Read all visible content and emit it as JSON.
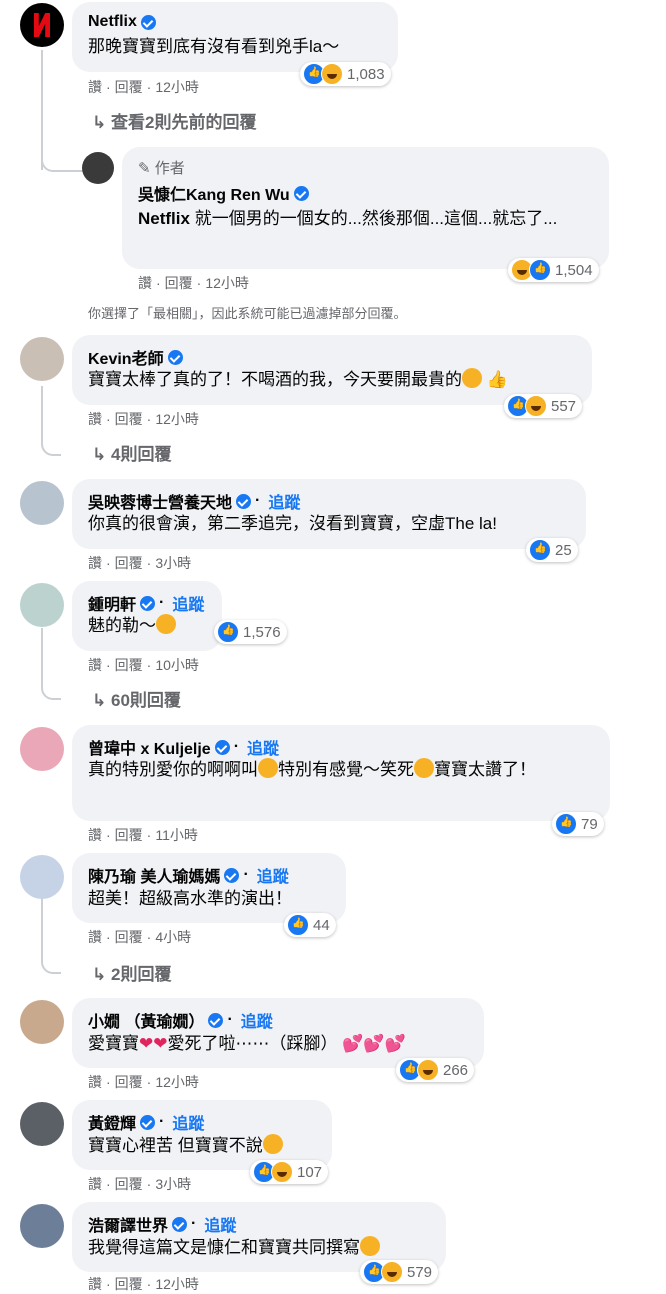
{
  "comments": [
    {
      "name": "Netflix",
      "follow": "",
      "text": "那晚寶寶到底有沒有看到兇手la～",
      "like": "讚",
      "reply": "回覆",
      "time": "12小時",
      "count": "1,083",
      "more": "查看2則先前的回覆"
    },
    {
      "author_badge": "作者",
      "name": "吳慷仁Kang Ren Wu",
      "text_tag": "Netflix",
      "text": " 就一個男的一個女的...然後那個...這個...就忘了...",
      "like": "讚",
      "reply": "回覆",
      "time": "12小時",
      "count": "1,504"
    },
    {
      "note": "你選擇了「最相關」，因此系統可能已過濾掉部分回覆。"
    },
    {
      "name": "Kevin老師",
      "follow": "",
      "text": "寶寶太棒了真的了！不喝酒的我，今天要開最貴的",
      "like": "讚",
      "reply": "回覆",
      "time": "12小時",
      "count": "557",
      "more": "4則回覆"
    },
    {
      "name": "吳映蓉博士營養天地",
      "follow": "追蹤",
      "text": "你真的很會演，第二季追完，沒看到寶寶，空虛The la!",
      "like": "讚",
      "reply": "回覆",
      "time": "3小時",
      "count": "25"
    },
    {
      "name": "鍾明軒",
      "follow": "追蹤",
      "text": "魅的勒～",
      "like": "讚",
      "reply": "回覆",
      "time": "10小時",
      "count": "1,576",
      "more": "60則回覆"
    },
    {
      "name": "曾瑋中 x Kuljelje",
      "follow": "追蹤",
      "text": "真的特別愛你的啊啊叫",
      "text2": "特別有感覺～笑死",
      "text3": "寶寶太讚了！",
      "like": "讚",
      "reply": "回覆",
      "time": "11小時",
      "count": "79"
    },
    {
      "name": "陳乃瑜 美人瑜媽媽",
      "follow": "追蹤",
      "text": "超美！超級高水準的演出！",
      "like": "讚",
      "reply": "回覆",
      "time": "4小時",
      "count": "44",
      "more": "2則回覆"
    },
    {
      "name": "小嫺 （黃瑜嫺）",
      "follow": "追蹤",
      "text": "愛寶寶",
      "text2": "愛死了啦⋯⋯（踩腳）",
      "like": "讚",
      "reply": "回覆",
      "time": "12小時",
      "count": "266"
    },
    {
      "name": "黃鐙輝",
      "follow": "追蹤",
      "text": "寶寶心裡苦 但寶寶不說",
      "like": "讚",
      "reply": "回覆",
      "time": "3小時",
      "count": "107"
    },
    {
      "name": "浩爾譯世界",
      "follow": "追蹤",
      "text": "我覺得這篇文是慷仁和寶寶共同撰寫",
      "like": "讚",
      "reply": "回覆",
      "time": "12小時",
      "count": "579"
    }
  ],
  "colors": {
    "link": "#1877f2",
    "bubble": "#f0f2f5",
    "muted": "#65676b"
  }
}
